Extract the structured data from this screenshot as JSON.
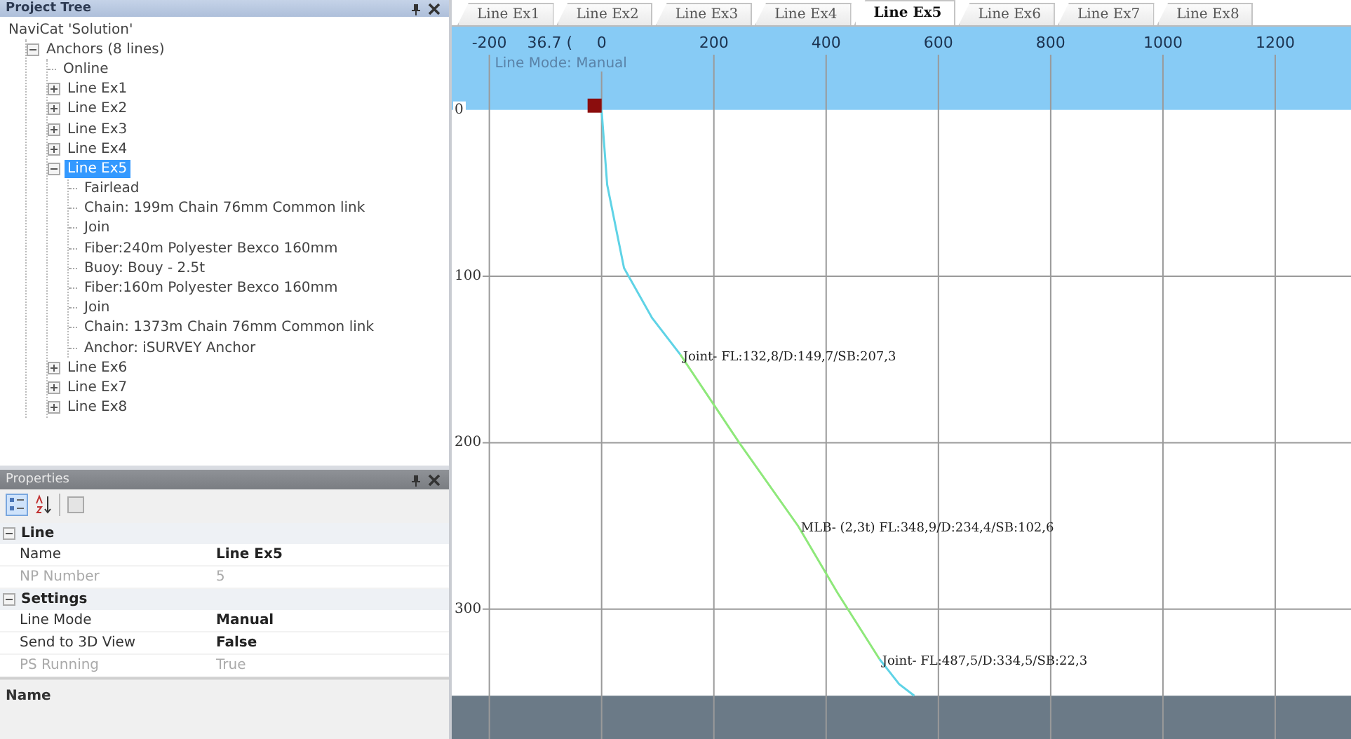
{
  "project_tree": {
    "title": "Project Tree",
    "items": [
      {
        "label": "NaviCat 'Solution'",
        "selected": false,
        "children": [
          {
            "label": "Anchors (8 lines)",
            "selected": false,
            "expanded": true,
            "children": [
              {
                "label": "Online",
                "selected": false
              },
              {
                "label": "Line Ex1",
                "selected": false,
                "expanded": false
              },
              {
                "label": "Line Ex2",
                "selected": false,
                "expanded": false
              },
              {
                "label": "Line Ex3",
                "selected": false,
                "expanded": false
              },
              {
                "label": "Line Ex4",
                "selected": false,
                "expanded": false
              },
              {
                "label": "Line Ex5",
                "selected": true,
                "expanded": true,
                "children": [
                  {
                    "label": "Fairlead",
                    "selected": false
                  },
                  {
                    "label": "Chain: 199m Chain 76mm Common link",
                    "selected": false
                  },
                  {
                    "label": "Join",
                    "selected": false
                  },
                  {
                    "label": "Fiber:240m Polyester Bexco 160mm",
                    "selected": false
                  },
                  {
                    "label": "Buoy: Bouy - 2.5t",
                    "selected": false
                  },
                  {
                    "label": "Fiber:160m Polyester Bexco 160mm",
                    "selected": false
                  },
                  {
                    "label": "Join",
                    "selected": false
                  },
                  {
                    "label": "Chain: 1373m Chain 76mm Common link",
                    "selected": false
                  },
                  {
                    "label": "Anchor: iSURVEY Anchor",
                    "selected": false
                  }
                ]
              },
              {
                "label": "Line Ex6",
                "selected": false,
                "expanded": false
              },
              {
                "label": "Line Ex7",
                "selected": false,
                "expanded": false
              },
              {
                "label": "Line Ex8",
                "selected": false,
                "expanded": false
              }
            ]
          }
        ]
      }
    ]
  },
  "properties": {
    "title": "Properties",
    "toolbar": [
      {
        "kind": "categorized",
        "selected": true
      },
      {
        "kind": "alphabetical",
        "selected": false
      },
      {
        "kind": "pages",
        "selected": false
      }
    ],
    "categories": [
      {
        "label": "Line",
        "expanded": true,
        "rows": [
          {
            "name": "Name",
            "value": "Line Ex5",
            "modified": true,
            "readonly": false
          },
          {
            "name": "NP Number",
            "value": "5",
            "modified": false,
            "readonly": true
          }
        ]
      },
      {
        "label": "Settings",
        "expanded": true,
        "rows": [
          {
            "name": "Line Mode",
            "value": "Manual",
            "modified": true,
            "readonly": false
          },
          {
            "name": "Send to 3D View",
            "value": "False",
            "modified": true,
            "readonly": false
          },
          {
            "name": "PS Running",
            "value": "True",
            "modified": false,
            "readonly": true
          }
        ]
      }
    ],
    "description": "Name"
  },
  "tabs": [
    {
      "label": "Line Ex1",
      "selected": false
    },
    {
      "label": "Line Ex2",
      "selected": false
    },
    {
      "label": "Line Ex3",
      "selected": false
    },
    {
      "label": "Line Ex4",
      "selected": false
    },
    {
      "label": "Line Ex5",
      "selected": true
    },
    {
      "label": "Line Ex6",
      "selected": false
    },
    {
      "label": "Line Ex7",
      "selected": false
    },
    {
      "label": "Line Ex8",
      "selected": false
    }
  ],
  "plot": {
    "mode_text": "Line Mode: Manual",
    "cursor_text": "36.7 (",
    "chart_data": {
      "type": "line",
      "xlim": [
        -267,
        1335
      ],
      "ylim": [
        378,
        -50
      ],
      "grid": true,
      "bands": [
        {
          "axis": "y",
          "from": -50,
          "to": 0,
          "color": "#87cbf5"
        },
        {
          "axis": "y",
          "from": 352,
          "to": 378,
          "color": "#6b7a87"
        }
      ],
      "xticks": [
        -200,
        0,
        200,
        400,
        600,
        800,
        1000,
        1200
      ],
      "yticks": [
        0,
        100,
        200,
        300
      ],
      "x": [
        0,
        10,
        40,
        90,
        140,
        245,
        350,
        420,
        495,
        530,
        557
      ],
      "series": [
        {
          "color": "#5fd3e6",
          "values": [
            0,
            45,
            95,
            125,
            147,
            null,
            null,
            null,
            null,
            null,
            null
          ]
        },
        {
          "color": "#8ee87a",
          "values": [
            null,
            null,
            null,
            null,
            147,
            200,
            250,
            290,
            330,
            null,
            null
          ]
        },
        {
          "color": "#5fd3e6",
          "values": [
            null,
            null,
            null,
            null,
            null,
            null,
            null,
            null,
            330,
            345,
            352
          ]
        }
      ],
      "annotations": [
        {
          "text": "Joint- FL:132,8/D:149,7/SB:207,3",
          "x": 140,
          "y": 147
        },
        {
          "text": "MLB- (2,3t) FL:348,9/D:234,4/SB:102,6",
          "x": 350,
          "y": 250
        },
        {
          "text": "Joint- FL:487,5/D:334,5/SB:22,3",
          "x": 495,
          "y": 330
        }
      ]
    }
  }
}
